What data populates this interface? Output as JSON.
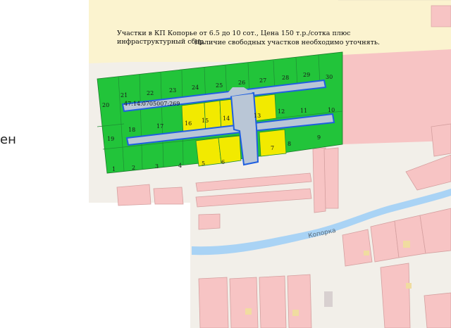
{
  "sidebar": {
    "fragment_top": "",
    "fragment_mid": "ен"
  },
  "map": {
    "title_line1": "Участки в КП Копорье от 6.5 до 10 сот., Цена 150 т.р./сотка плюс",
    "title_line2": "инфраструктурный сбор.",
    "title_line2b": "Наличие свободных участков необходимо уточнять.",
    "cadastral_number": "47:14:0705007:269",
    "river_label": "Копорка",
    "colors": {
      "plot_free": "#22c43a",
      "plot_sold": "#f2ea00",
      "road": "#b9c6d6",
      "road_outline": "#1f5fe0",
      "farm_field": "#fbf3cf",
      "building": "#f7c4c4",
      "river": "#a9d3f5"
    },
    "plots": [
      {
        "id": "1",
        "status": "free"
      },
      {
        "id": "2",
        "status": "free"
      },
      {
        "id": "3",
        "status": "free"
      },
      {
        "id": "4",
        "status": "free"
      },
      {
        "id": "5",
        "status": "sold"
      },
      {
        "id": "6",
        "status": "sold"
      },
      {
        "id": "7",
        "status": "sold"
      },
      {
        "id": "8",
        "status": "free"
      },
      {
        "id": "9",
        "status": "free"
      },
      {
        "id": "10",
        "status": "free"
      },
      {
        "id": "11",
        "status": "free"
      },
      {
        "id": "12",
        "status": "free"
      },
      {
        "id": "13",
        "status": "sold"
      },
      {
        "id": "14",
        "status": "sold"
      },
      {
        "id": "15",
        "status": "sold"
      },
      {
        "id": "16",
        "status": "sold"
      },
      {
        "id": "17",
        "status": "free"
      },
      {
        "id": "18",
        "status": "free"
      },
      {
        "id": "19",
        "status": "free"
      },
      {
        "id": "20",
        "status": "free"
      },
      {
        "id": "21",
        "status": "free"
      },
      {
        "id": "22",
        "status": "free"
      },
      {
        "id": "23",
        "status": "free"
      },
      {
        "id": "24",
        "status": "free"
      },
      {
        "id": "25",
        "status": "free"
      },
      {
        "id": "26",
        "status": "free"
      },
      {
        "id": "27",
        "status": "free"
      },
      {
        "id": "28",
        "status": "free"
      },
      {
        "id": "29",
        "status": "free"
      },
      {
        "id": "30",
        "status": "free"
      }
    ]
  }
}
